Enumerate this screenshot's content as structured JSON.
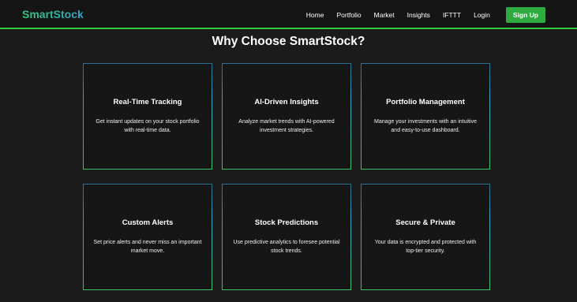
{
  "nav": {
    "brand": "SmartStock",
    "links": [
      "Home",
      "Portfolio",
      "Market",
      "Insights",
      "IFTTT",
      "Login"
    ],
    "signup_label": "Sign Up"
  },
  "section": {
    "heading": "Why Choose SmartStock?",
    "features": [
      {
        "title": "Real-Time Tracking",
        "description": "Get instant updates on your stock portfolio with real-time data."
      },
      {
        "title": "AI-Driven Insights",
        "description": "Analyze market trends with AI-powered investment strategies."
      },
      {
        "title": "Portfolio Management",
        "description": "Manage your investments with an intuitive and easy-to-use dashboard."
      },
      {
        "title": "Custom Alerts",
        "description": "Set price alerts and never miss an important market move."
      },
      {
        "title": "Stock Predictions",
        "description": "Use predictive analytics to foresee potential stock trends."
      },
      {
        "title": "Secure & Private",
        "description": "Your data is encrypted and protected with top-tier security."
      }
    ]
  },
  "colors": {
    "accent_green": "#2eaa3f",
    "border_blue": "#2fa5c9",
    "border_green": "#39c06a",
    "background": "#1b1b1b"
  }
}
